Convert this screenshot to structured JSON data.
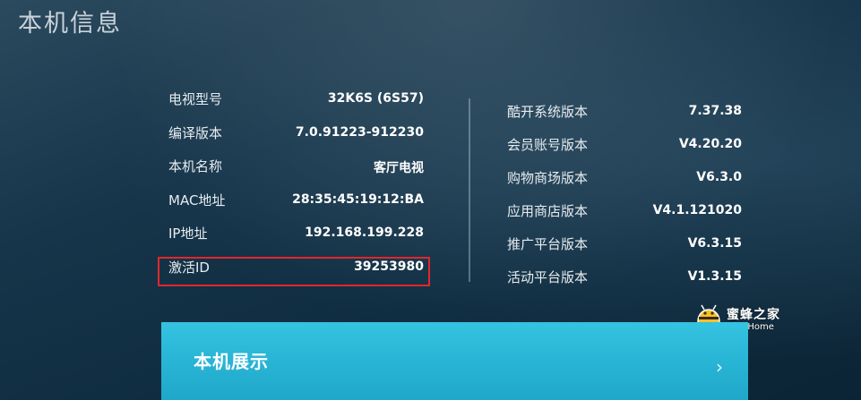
{
  "page": {
    "title": "本机信息"
  },
  "left_info": [
    {
      "label": "电视型号",
      "value": "32K6S (6S57)"
    },
    {
      "label": "编译版本",
      "value": "7.0.91223-912230"
    },
    {
      "label": "本机名称",
      "value": "客厅电视"
    },
    {
      "label": "MAC地址",
      "value": "28:35:45:19:12:BA"
    },
    {
      "label": "IP地址",
      "value": "192.168.199.228"
    },
    {
      "label": "激活ID",
      "value": "39253980"
    }
  ],
  "right_info": [
    {
      "label": "酷开系统版本",
      "value": "7.37.38"
    },
    {
      "label": "会员账号版本",
      "value": "V4.20.20"
    },
    {
      "label": "购物商场版本",
      "value": "V6.3.0"
    },
    {
      "label": "应用商店版本",
      "value": "V4.1.121020"
    },
    {
      "label": "推广平台版本",
      "value": "V6.3.15"
    },
    {
      "label": "活动平台版本",
      "value": "V1.3.15"
    }
  ],
  "banner": {
    "label": "本机展示",
    "arrow_icon": "chevron-right-icon"
  },
  "watermark": {
    "cn": "蜜蜂之家",
    "en": "Bee Home"
  },
  "colors": {
    "banner": "#27b3d4",
    "highlight": "#e2262b"
  }
}
